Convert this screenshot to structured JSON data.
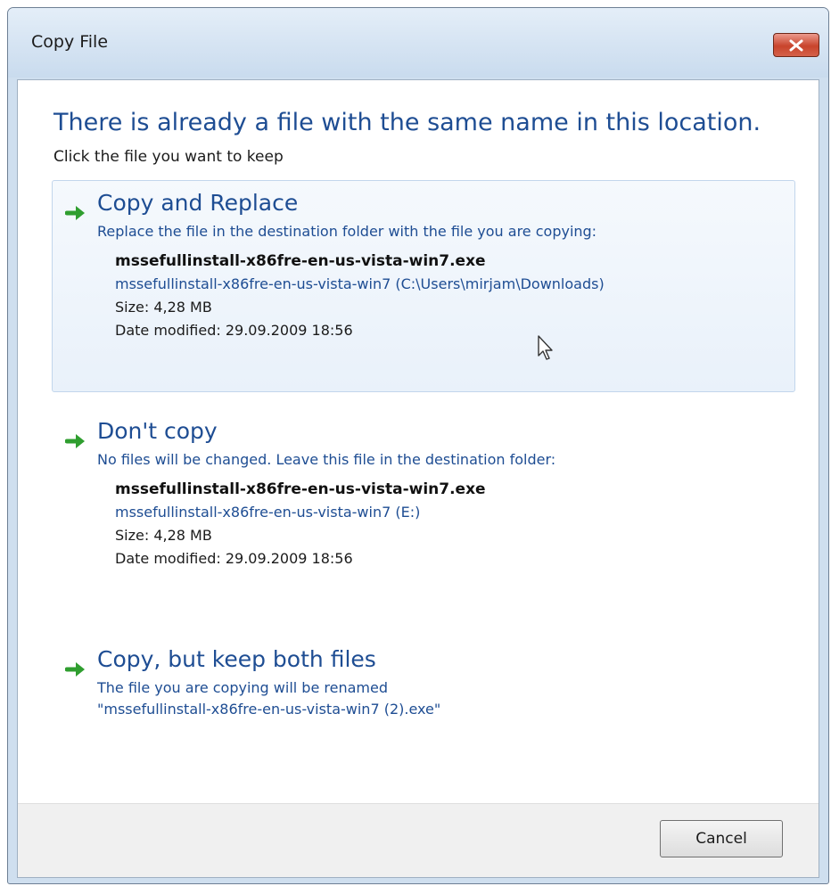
{
  "window": {
    "title": "Copy File"
  },
  "dialog": {
    "heading": "There is already a file with the same name in this location.",
    "subheading": "Click the file you want to keep"
  },
  "options": {
    "replace": {
      "title": "Copy and Replace",
      "description": "Replace the file in the destination folder with the file you are copying:",
      "file_name": "mssefullinstall-x86fre-en-us-vista-win7.exe",
      "file_path": "mssefullinstall-x86fre-en-us-vista-win7 (C:\\Users\\mirjam\\Downloads)",
      "size": "Size: 4,28 MB",
      "date_modified": "Date modified: 29.09.2009 18:56"
    },
    "dont_copy": {
      "title": "Don't copy",
      "description": "No files will be changed. Leave this file in the destination folder:",
      "file_name": "mssefullinstall-x86fre-en-us-vista-win7.exe",
      "file_path": "mssefullinstall-x86fre-en-us-vista-win7 (E:)",
      "size": "Size: 4,28 MB",
      "date_modified": "Date modified: 29.09.2009 18:56"
    },
    "keep_both": {
      "title": "Copy, but keep both files",
      "description": "The file you are copying will be renamed",
      "new_name": "\"mssefullinstall-x86fre-en-us-vista-win7 (2).exe\""
    }
  },
  "footer": {
    "cancel_label": "Cancel"
  },
  "icons": {
    "arrow": "green-right-arrow-icon",
    "close": "close-icon",
    "cursor": "mouse-pointer-icon"
  },
  "colors": {
    "link_blue": "#1e4d93",
    "arrow_green": "#2f9e2f",
    "close_red": "#c8442c",
    "hover_bg": "#e9f1fa"
  }
}
